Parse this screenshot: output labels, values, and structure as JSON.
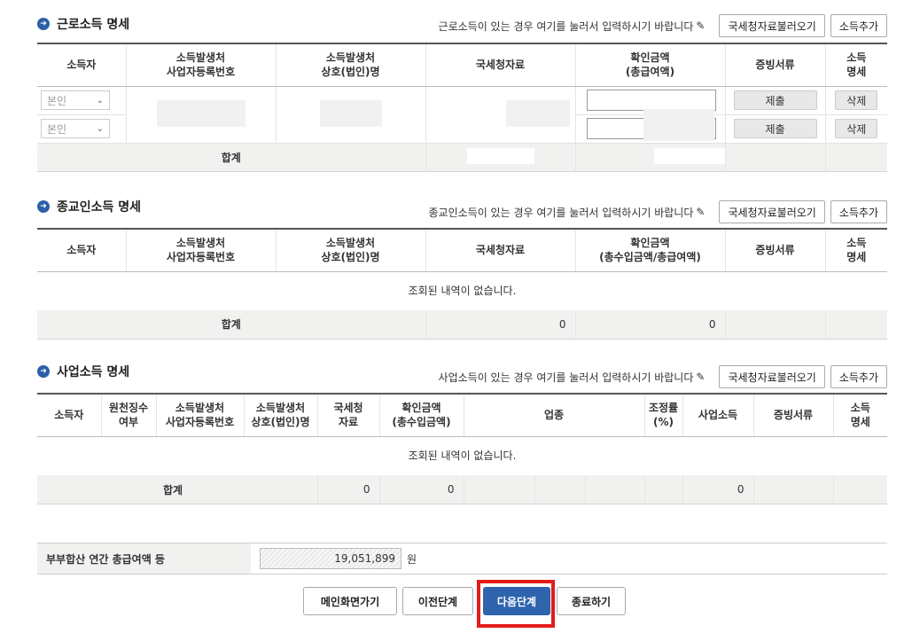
{
  "labor": {
    "title": "근로소득 명세",
    "note": "근로소득이 있는 경우 여기를 눌러서 입력하시기 바랍니다",
    "import_btn": "국세청자료불러오기",
    "add_btn": "소득추가",
    "headers": [
      "소득자",
      "소득발생처\n사업자등록번호",
      "소득발생처\n상호(법인)명",
      "국세청자료",
      "확인금액\n(총급여액)",
      "증빙서류",
      "소득\n명세"
    ],
    "rows": [
      {
        "earner": "본인",
        "submit": "제출",
        "delete": "삭제"
      },
      {
        "earner": "본인",
        "submit": "제출",
        "delete": "삭제"
      }
    ],
    "sum_label": "합계"
  },
  "religious": {
    "title": "종교인소득 명세",
    "note": "종교인소득이 있는 경우 여기를 눌러서 입력하시기 바랍니다",
    "import_btn": "국세청자료불러오기",
    "add_btn": "소득추가",
    "headers": [
      "소득자",
      "소득발생처\n사업자등록번호",
      "소득발생처\n상호(법인)명",
      "국세청자료",
      "확인금액\n(총수입금액/총급여액)",
      "증빙서류",
      "소득\n명세"
    ],
    "empty": "조회된 내역이 없습니다.",
    "sum_label": "합계",
    "sum_values": [
      "0",
      "0"
    ]
  },
  "business": {
    "title": "사업소득 명세",
    "note": "사업소득이 있는 경우 여기를 눌러서 입력하시기 바랍니다",
    "import_btn": "국세청자료불러오기",
    "add_btn": "소득추가",
    "headers": [
      "소득자",
      "원천징수\n여부",
      "소득발생처\n사업자등록번호",
      "소득발생처\n상호(법인)명",
      "국세청\n자료",
      "확인금액\n(총수입금액)",
      "업종",
      "조정률\n(%)",
      "사업소득",
      "증빙서류",
      "소득\n명세"
    ],
    "empty": "조회된 내역이 없습니다.",
    "sum_label": "합계",
    "sum_values": [
      "0",
      "0",
      "0"
    ]
  },
  "total": {
    "label": "부부합산 연간 총급여액 등",
    "value": "19,051,899",
    "unit": "원"
  },
  "buttons": {
    "main": "메인화면가기",
    "prev": "이전단계",
    "next": "다음단계",
    "end": "종료하기"
  },
  "colors": {
    "primary": "#2e63ad",
    "highlight": "#e31b1b",
    "sum_bg": "#f1f1ef"
  }
}
